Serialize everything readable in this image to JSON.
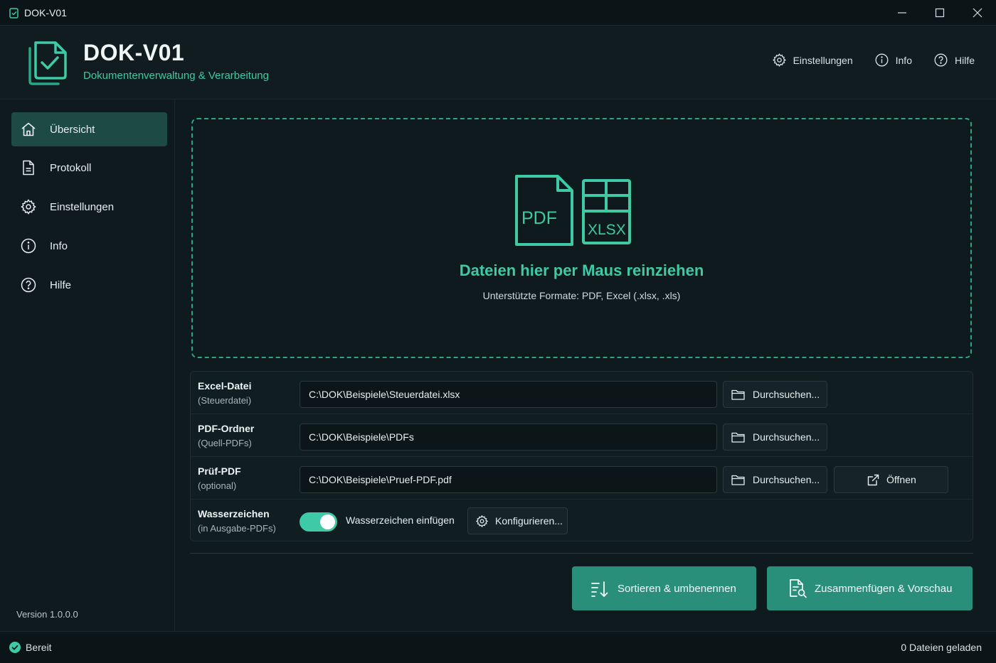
{
  "window": {
    "title": "DOK-V01"
  },
  "header": {
    "app_name": "DOK-V01",
    "app_subtitle": "Dokumentenverwaltung & Verarbeitung",
    "nav": [
      {
        "icon": "gear-icon",
        "label": "Einstellungen"
      },
      {
        "icon": "info-icon",
        "label": "Info"
      },
      {
        "icon": "help-icon",
        "label": "Hilfe"
      }
    ]
  },
  "sidebar": {
    "items": [
      {
        "icon": "home-icon",
        "label": "Übersicht",
        "active": true
      },
      {
        "icon": "document-icon",
        "label": "Protokoll"
      },
      {
        "icon": "gear-icon",
        "label": "Einstellungen"
      },
      {
        "icon": "info-icon",
        "label": "Info"
      },
      {
        "icon": "help-icon",
        "label": "Hilfe"
      }
    ],
    "version": "Version 1.0.0.0"
  },
  "dropzone": {
    "pdf_label": "PDF",
    "xlsx_label": "XLSX",
    "title": "Dateien hier per Maus reinziehen",
    "subtitle": "Unterstützte Formate: PDF, Excel (.xlsx, .xls)"
  },
  "settings": {
    "excel": {
      "label": "Excel-Datei",
      "sublabel": "(Steuerdatei)",
      "value": "C:\\DOK\\Beispiele\\Steuerdatei.xlsx",
      "browse": "Durchsuchen..."
    },
    "pdf_folder": {
      "label": "PDF-Ordner",
      "sublabel": "(Quell-PDFs)",
      "value": "C:\\DOK\\Beispiele\\PDFs",
      "browse": "Durchsuchen..."
    },
    "check_pdf": {
      "label": "Prüf-PDF",
      "sublabel": "(optional)",
      "value": "C:\\DOK\\Beispiele\\Pruef-PDF.pdf",
      "browse": "Durchsuchen...",
      "open": "Öffnen"
    },
    "watermark": {
      "label": "Wasserzeichen",
      "sublabel": "(in Ausgabe-PDFs)",
      "enabled": true,
      "toggle_label": "Wasserzeichen einfügen",
      "configure": "Konfigurieren..."
    }
  },
  "actions": {
    "sort": "Sortieren & umbenennen",
    "merge": "Zusammenfügen & Vorschau"
  },
  "status": {
    "text": "Bereit",
    "files": "0 Dateien geladen"
  },
  "colors": {
    "accent": "#3ec9a7",
    "accent_dark": "#2a8f7a",
    "active_nav": "#1e4a44",
    "background": "#0f1a1e",
    "status_ok": "#3ec9a7"
  }
}
